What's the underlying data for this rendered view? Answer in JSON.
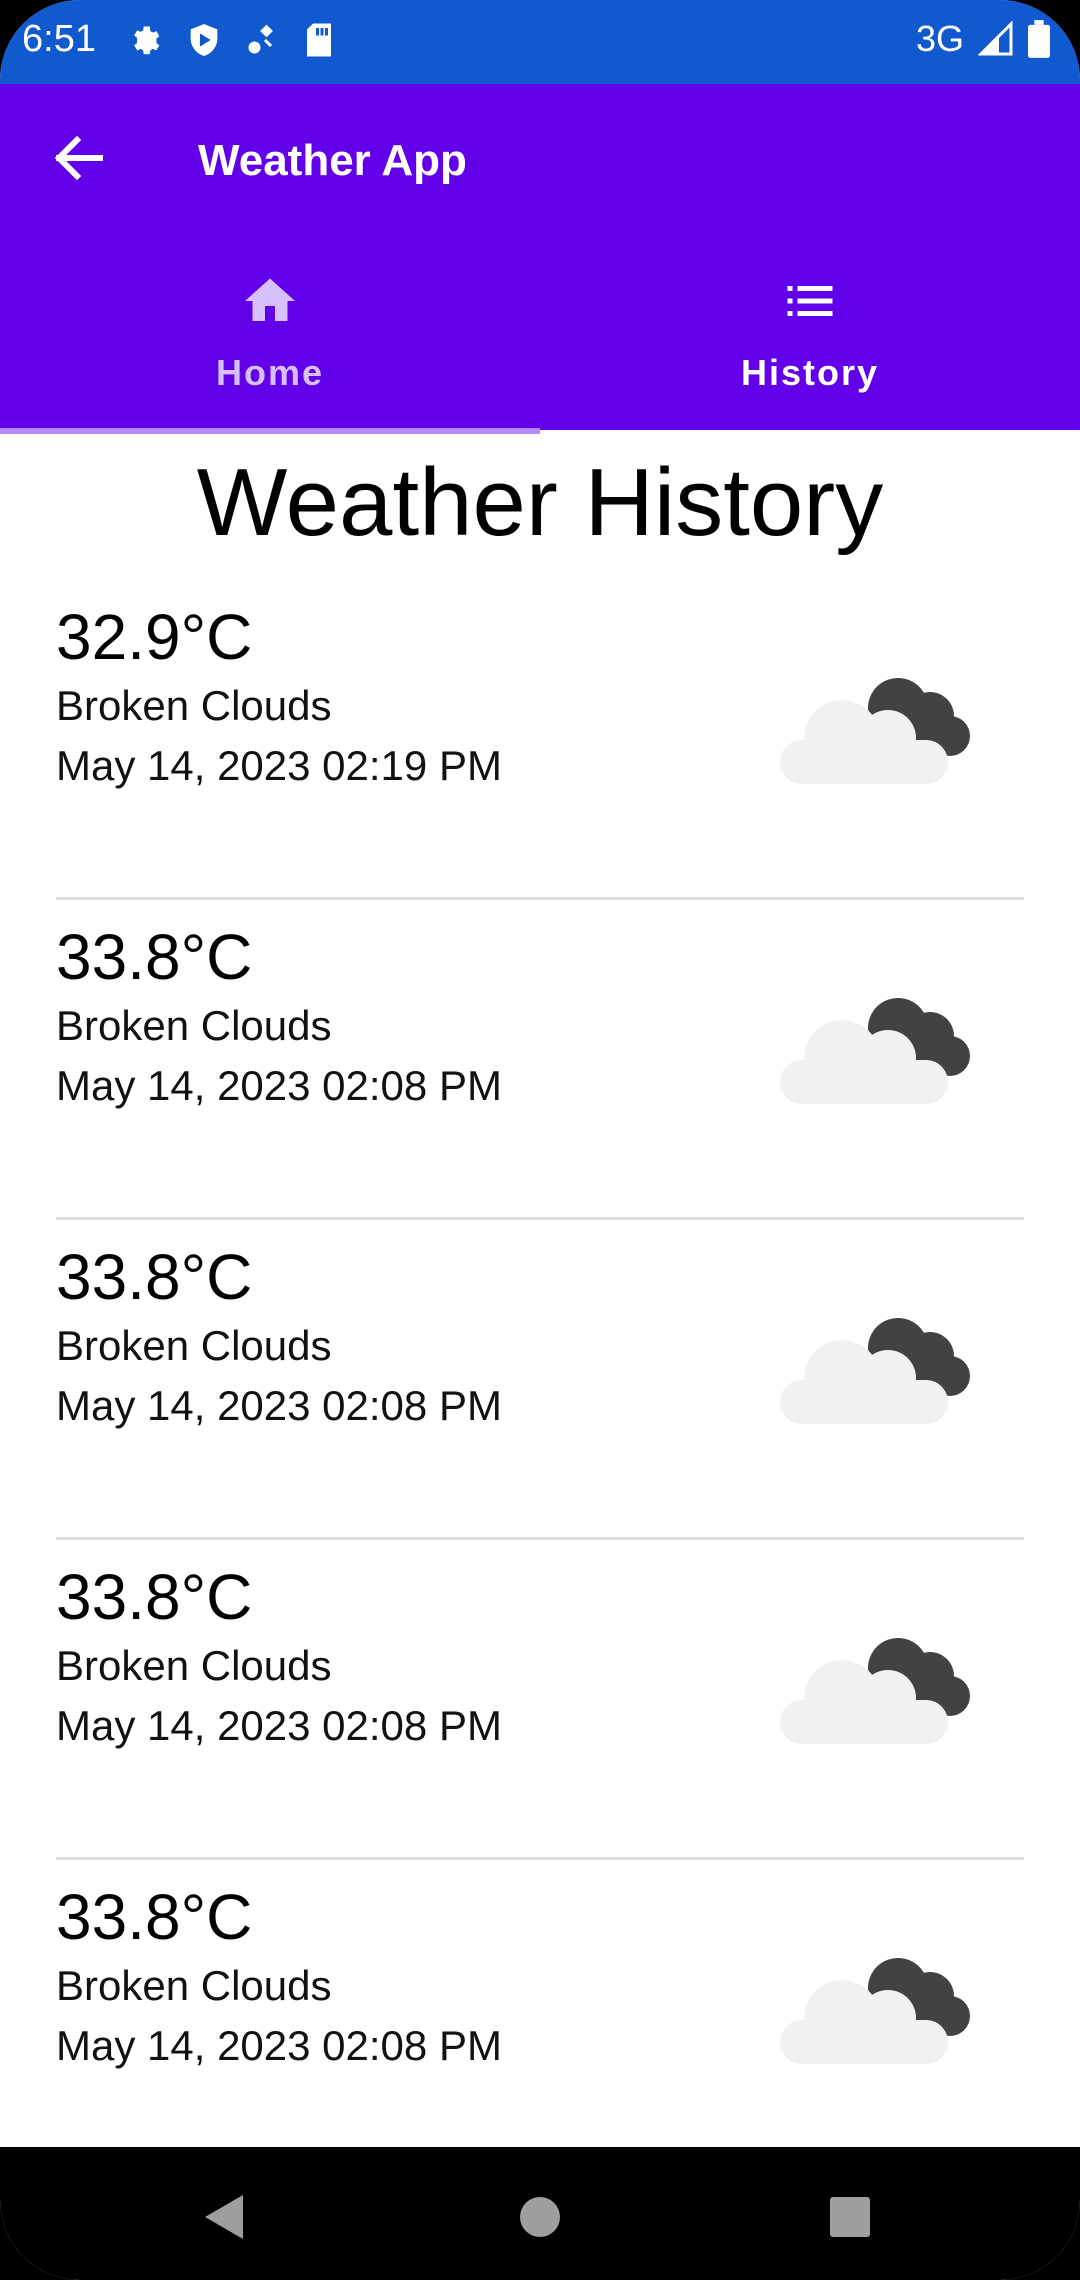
{
  "status_bar": {
    "time": "6:51",
    "network": "3G",
    "left_icons": [
      "settings-icon",
      "shield-icon",
      "satellite-icon",
      "sd-card-icon"
    ],
    "right_icons": [
      "signal-icon",
      "battery-icon"
    ]
  },
  "app_bar": {
    "title": "Weather App",
    "back_icon": "arrow-left-icon",
    "colors": {
      "status": "#1059cf",
      "primary": "#6200ea",
      "indicator": "#b48cff"
    }
  },
  "tabs": [
    {
      "label": "Home",
      "icon": "home-icon",
      "selected": true
    },
    {
      "label": "History",
      "icon": "list-icon",
      "selected": false
    }
  ],
  "page": {
    "title": "Weather History"
  },
  "history": [
    {
      "temp": "32.9°C",
      "desc": "Broken Clouds",
      "date": "May 14, 2023 02:19 PM",
      "icon": "broken-clouds-icon"
    },
    {
      "temp": "33.8°C",
      "desc": "Broken Clouds",
      "date": "May 14, 2023 02:08 PM",
      "icon": "broken-clouds-icon"
    },
    {
      "temp": "33.8°C",
      "desc": "Broken Clouds",
      "date": "May 14, 2023 02:08 PM",
      "icon": "broken-clouds-icon"
    },
    {
      "temp": "33.8°C",
      "desc": "Broken Clouds",
      "date": "May 14, 2023 02:08 PM",
      "icon": "broken-clouds-icon"
    },
    {
      "temp": "33.8°C",
      "desc": "Broken Clouds",
      "date": "May 14, 2023 02:08 PM",
      "icon": "broken-clouds-icon"
    }
  ],
  "nav": {
    "buttons": [
      "back-triangle-icon",
      "home-circle-icon",
      "recents-square-icon"
    ]
  }
}
